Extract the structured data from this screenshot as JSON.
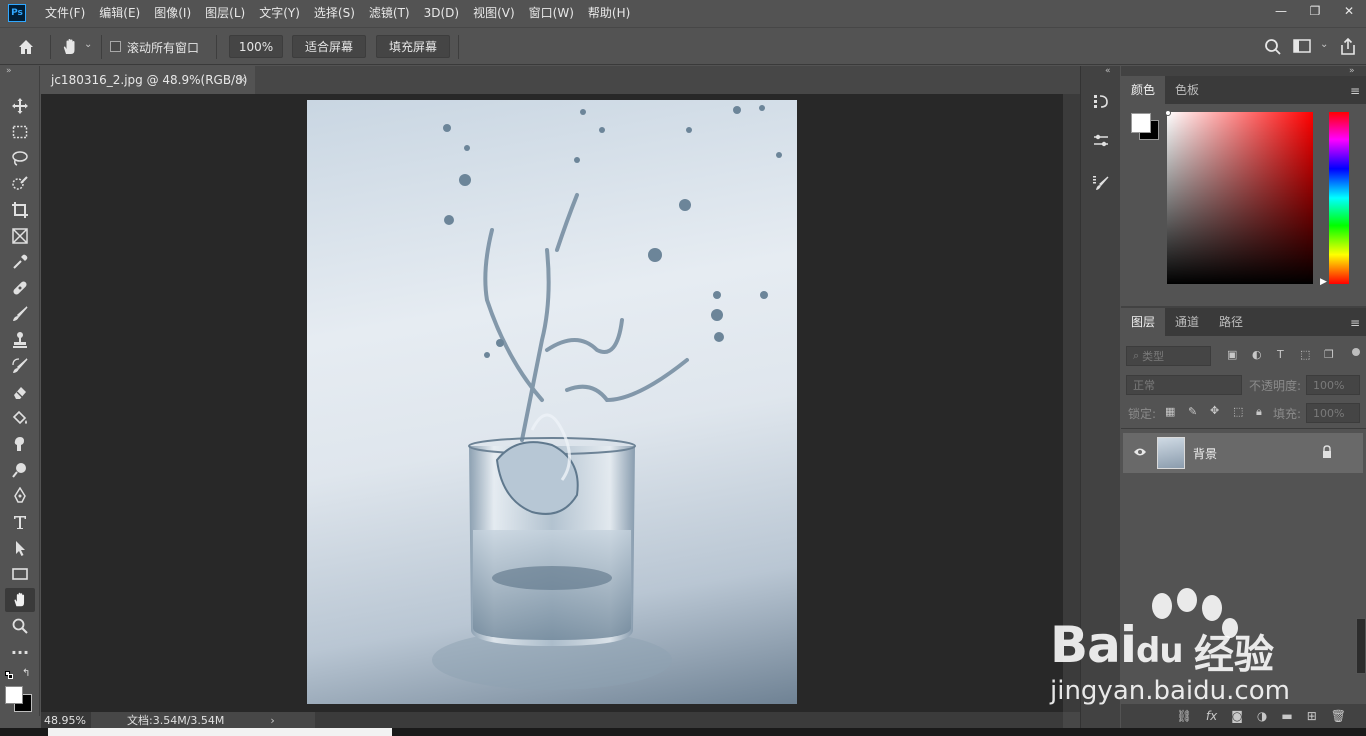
{
  "app": {
    "logo_text": "Ps",
    "menus": [
      "文件(F)",
      "编辑(E)",
      "图像(I)",
      "图层(L)",
      "文字(Y)",
      "选择(S)",
      "滤镜(T)",
      "3D(D)",
      "视图(V)",
      "窗口(W)",
      "帮助(H)"
    ],
    "window_controls": [
      "—",
      "❐",
      "✕"
    ]
  },
  "options_bar": {
    "scroll_all_windows_label": "滚动所有窗口",
    "zoom_button": "100%",
    "fit_screen_button": "适合屏幕",
    "fill_screen_button": "填充屏幕"
  },
  "document": {
    "tab_title": "jc180316_2.jpg @ 48.9%(RGB/8)",
    "close_glyph": "×"
  },
  "status_bar": {
    "zoom": "48.95%",
    "doc_info": "文档:3.54M/3.54M",
    "arrow": "›"
  },
  "color_panel": {
    "tabs": [
      "颜色",
      "色板"
    ],
    "foreground_color": "#ffffff",
    "background_color": "#000000"
  },
  "layers_panel": {
    "tabs": [
      "图层",
      "通道",
      "路径"
    ],
    "filter_placeholder": "类型",
    "blend_mode": "正常",
    "opacity_label": "不透明度:",
    "opacity_value": "100%",
    "lock_label": "锁定:",
    "fill_label": "填充:",
    "fill_value": "100%",
    "layers": [
      {
        "name": "背景",
        "visible": true,
        "locked": true
      }
    ]
  },
  "watermark": {
    "brand": "Bai",
    "brand_du": "du",
    "brand_cn": "经验",
    "url": "jingyan.baidu.com"
  }
}
